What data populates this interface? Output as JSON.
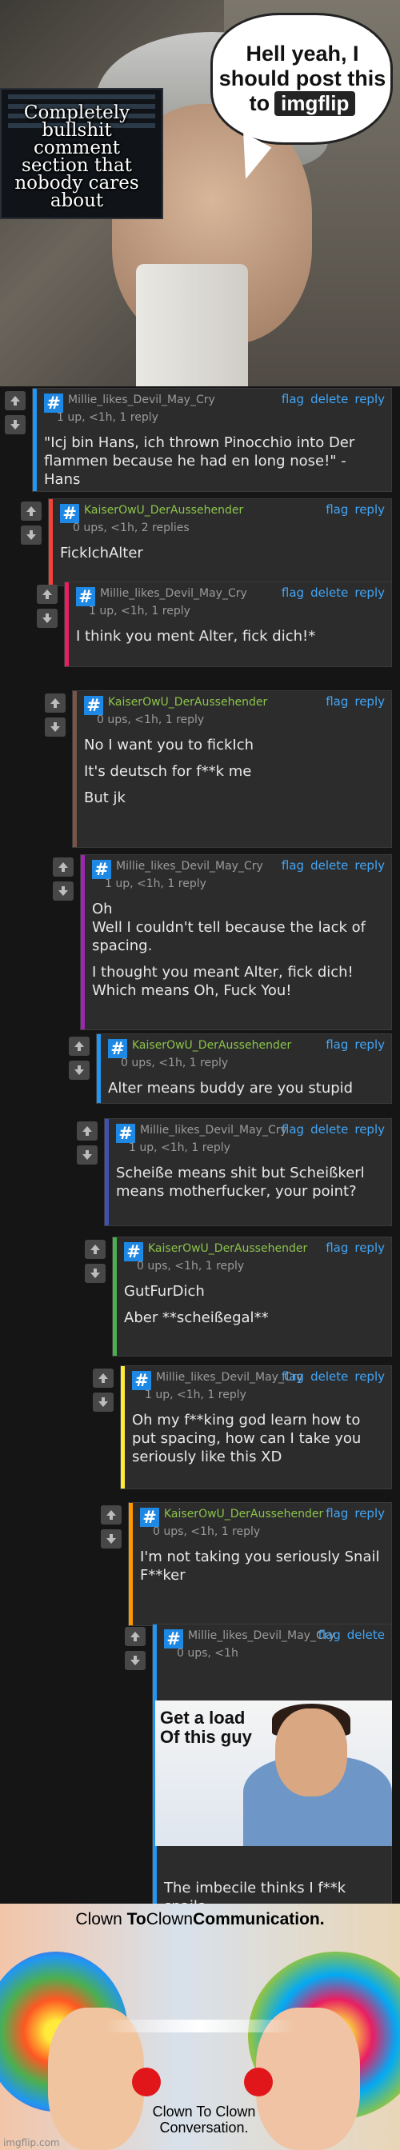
{
  "hero": {
    "bubble_line1": "Hell yeah, I",
    "bubble_line2": "should post this",
    "bubble_to": "to",
    "bubble_logo": "imgflip",
    "overlay_text": "Completely bullshit comment section that nobody cares about"
  },
  "comments": [
    {
      "user": "Millie_likes_Devil_May_Cry",
      "meta": "1 up, <1h, 1 reply",
      "flag": "flag",
      "delete": "delete",
      "reply": "reply",
      "paragraphs": [
        "\"Icj bin Hans, ich thrown Pinocchio into Der flammen because he had en long nose!\" - Hans"
      ]
    },
    {
      "user": "KaiserOwU_DerAussehender",
      "meta": "0 ups, <1h, 2 replies",
      "flag": "flag",
      "delete": "",
      "reply": "reply",
      "paragraphs": [
        "FickIchAlter"
      ]
    },
    {
      "user": "Millie_likes_Devil_May_Cry",
      "meta": "1 up, <1h, 1 reply",
      "flag": "flag",
      "delete": "delete",
      "reply": "reply",
      "paragraphs": [
        "I think you ment Alter, fick dich!*"
      ]
    },
    {
      "user": "KaiserOwU_DerAussehender",
      "meta": "0 ups, <1h, 1 reply",
      "flag": "flag",
      "delete": "",
      "reply": "reply",
      "paragraphs": [
        "No I want you to fickIch",
        "It's deutsch for f**k me",
        "But jk"
      ]
    },
    {
      "user": "Millie_likes_Devil_May_Cry",
      "meta": "1 up, <1h, 1 reply",
      "flag": "flag",
      "delete": "delete",
      "reply": "reply",
      "paragraphs": [
        "Oh\nWell I couldn't tell because the lack of spacing.",
        "I thought you meant Alter, fick dich! Which means Oh, Fuck You!"
      ]
    },
    {
      "user": "KaiserOwU_DerAussehender",
      "meta": "0 ups, <1h, 1 reply",
      "flag": "flag",
      "delete": "",
      "reply": "reply",
      "paragraphs": [
        "Alter means buddy are you stupid"
      ]
    },
    {
      "user": "Millie_likes_Devil_May_Cry",
      "meta": "1 up, <1h, 1 reply",
      "flag": "flag",
      "delete": "delete",
      "reply": "reply",
      "paragraphs": [
        "Scheiße means shit but Scheißkerl means motherfucker, your point?"
      ]
    },
    {
      "user": "KaiserOwU_DerAussehender",
      "meta": "0 ups, <1h, 1 reply",
      "flag": "flag",
      "delete": "",
      "reply": "reply",
      "paragraphs": [
        "GutFurDich",
        "Aber **scheißegal**"
      ]
    },
    {
      "user": "Millie_likes_Devil_May_Cry",
      "meta": "1 up, <1h, 1 reply",
      "flag": "flag",
      "delete": "delete",
      "reply": "reply",
      "paragraphs": [
        "Oh my f**king god learn how to put spacing, how can I take you seriously like this XD"
      ]
    },
    {
      "user": "KaiserOwU_DerAussehender",
      "meta": "0 ups, <1h, 1 reply",
      "flag": "flag",
      "delete": "",
      "reply": "reply",
      "paragraphs": [
        "I'm not taking you seriously Snail F**ker"
      ]
    },
    {
      "user": "Millie_likes_Devil_May_Cry",
      "meta": "0 ups, <1h",
      "flag": "flag",
      "delete": "delete",
      "reply": "",
      "paragraphs": [
        "The imbecile thinks I f**k snails"
      ]
    }
  ],
  "image_caption": "Get a load Of this guy",
  "clown": {
    "top_title_1": "Clown ",
    "top_title_2": "To",
    "top_title_3": "Clown",
    "top_title_4": "Communication.",
    "bottom_title": "Clown To Clown Conversation.",
    "watermark": "imgflip.com"
  },
  "colors": {
    "bars": [
      "#2196f3",
      "#f44336",
      "#e91e63",
      "#795548",
      "#9c27b0",
      "#2196f3",
      "#3f51b5",
      "#4caf50",
      "#ffeb3b",
      "#ff9800",
      "#2196f3"
    ],
    "link": "#42a5f5",
    "green_user": "#8bc34a"
  }
}
